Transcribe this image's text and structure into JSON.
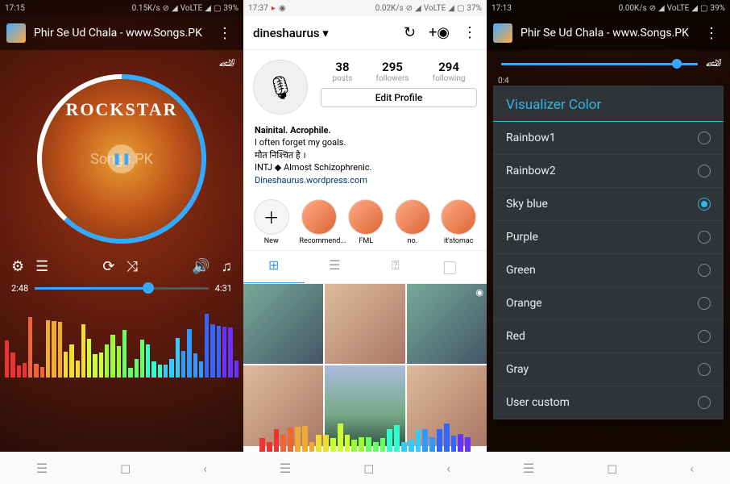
{
  "s1": {
    "status": {
      "time": "17:15",
      "net": "0.15K/s",
      "volte": "VoLTE",
      "batt": "39%"
    },
    "title": "Phir Se Ud Chala - www.Songs.PK",
    "album_title": "ROCKSTAR",
    "album_sub": "Songs.PK",
    "time_current": "2:48",
    "time_total": "4:31"
  },
  "s2": {
    "status": {
      "time": "17:37",
      "net": "0.02K/s",
      "volte": "VoLTE",
      "batt": "37%"
    },
    "username": "dineshaurus",
    "stats": {
      "posts": "38",
      "followers": "295",
      "following": "294"
    },
    "labels": {
      "posts": "posts",
      "followers": "followers",
      "following": "following"
    },
    "edit": "Edit Profile",
    "bio": {
      "l1": "Nainital. Acrophile.",
      "l2": "I often forget my goals.",
      "l3": "मौत निश्चित है ।",
      "l4": "INTJ ◆ Almost Schizophrenic.",
      "link": "Dineshaurus.wordpress.com"
    },
    "stories": [
      {
        "label": "New"
      },
      {
        "label": "Recommend..."
      },
      {
        "label": "FML"
      },
      {
        "label": "no."
      },
      {
        "label": "it'stomac"
      }
    ]
  },
  "s3": {
    "status": {
      "time": "17:13",
      "net": "0.00K/s",
      "volte": "VoLTE",
      "batt": "39%"
    },
    "title": "Phir Se Ud Chala - www.Songs.PK",
    "dialog_title": "Visualizer Color",
    "time_hint": "0:4",
    "options": [
      "Rainbow1",
      "Rainbow2",
      "Sky blue",
      "Purple",
      "Green",
      "Orange",
      "Red",
      "Gray",
      "User custom"
    ],
    "selected": 2
  }
}
